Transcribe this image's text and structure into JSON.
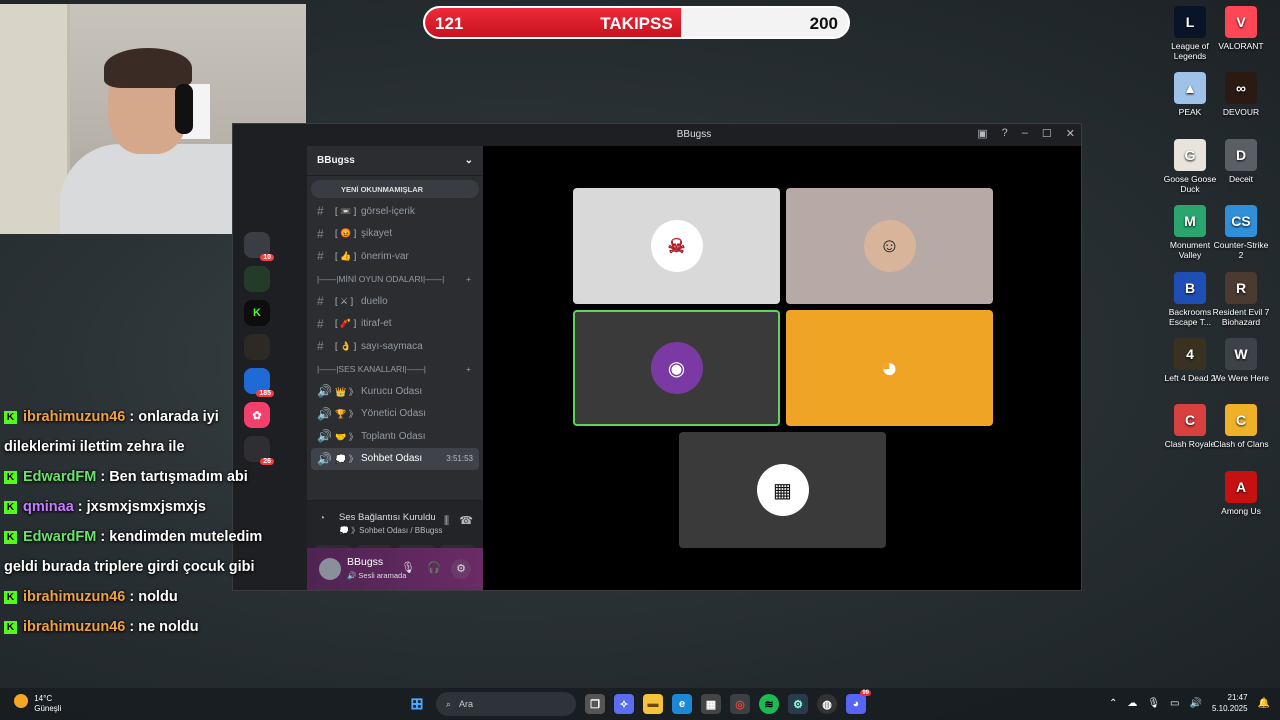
{
  "goal": {
    "current": "121",
    "label": "TAKIPSS",
    "target": "200",
    "progress_fraction": 0.605
  },
  "desktop_icons": [
    {
      "label": "League of Legends",
      "icon": "league-of-legends-icon",
      "bg": "#0a1428",
      "glyph": "L"
    },
    {
      "label": "VALORANT",
      "icon": "valorant-icon",
      "bg": "#ff4655",
      "glyph": "V"
    },
    {
      "label": "PEAK",
      "icon": "peak-icon",
      "bg": "#9fc3e8",
      "glyph": "▲"
    },
    {
      "label": "DEVOUR",
      "icon": "devour-icon",
      "bg": "#2a1a12",
      "glyph": "∞"
    },
    {
      "label": "Goose Goose Duck",
      "icon": "goose-goose-duck-icon",
      "bg": "#e8e4dc",
      "glyph": "G"
    },
    {
      "label": "Deceit",
      "icon": "deceit-icon",
      "bg": "#5a5f66",
      "glyph": "D"
    },
    {
      "label": "Monument Valley",
      "icon": "monument-valley-icon",
      "bg": "#2aa56e",
      "glyph": "M"
    },
    {
      "label": "Counter-Strike 2",
      "icon": "counter-strike-icon",
      "bg": "#2f8fd8",
      "glyph": "CS"
    },
    {
      "label": "Backrooms Escape T...",
      "icon": "backrooms-icon",
      "bg": "#1f4fb5",
      "glyph": "B"
    },
    {
      "label": "Resident Evil 7 Biohazard",
      "icon": "resident-evil-icon",
      "bg": "#4a3a30",
      "glyph": "R"
    },
    {
      "label": "Left 4 Dead 2",
      "icon": "left4dead-icon",
      "bg": "#3a3220",
      "glyph": "4"
    },
    {
      "label": "We Were Here",
      "icon": "we-were-here-icon",
      "bg": "#3d4148",
      "glyph": "W"
    },
    {
      "label": "Clash Royale",
      "icon": "clash-royale-icon",
      "bg": "#d94040",
      "glyph": "C"
    },
    {
      "label": "Clash of Clans",
      "icon": "clash-of-clans-icon",
      "bg": "#f0b12a",
      "glyph": "C"
    },
    {
      "label": "Among Us",
      "icon": "among-us-icon",
      "bg": "#c51111",
      "glyph": "A"
    }
  ],
  "discord": {
    "window_title": "BBugss",
    "server_name": "BBugss",
    "unread_banner": "YENİ OKUNMAMIŞLAR",
    "text_channels": [
      {
        "emoji": "[ 📼 ]",
        "name": "görsel-içerik"
      },
      {
        "emoji": "[ 😡 ]",
        "name": "şikayet"
      },
      {
        "emoji": "[ 👍 ]",
        "name": "önerim-var"
      }
    ],
    "cat_mini": "|——|MİNİ OYUN ODALARI|——|",
    "game_channels": [
      {
        "emoji": "[ ⚔ ]",
        "name": "duello"
      },
      {
        "emoji": "[ 🧨 ]",
        "name": "itiraf-et"
      },
      {
        "emoji": "[ 👌 ]",
        "name": "sayı-saymaca"
      }
    ],
    "cat_voice": "|——|SES KANALLARI|——|",
    "voice_channels": [
      {
        "emoji": "👑 》",
        "name": "Kurucu Odası"
      },
      {
        "emoji": "🏆 》",
        "name": "Yönetici Odası"
      },
      {
        "emoji": "🤝 》",
        "name": "Toplantı Odası"
      },
      {
        "emoji": "💭 》",
        "name": "Sohbet Odası",
        "time": "3:51:53"
      }
    ],
    "voice_status": "Ses Bağlantısı Kuruldu",
    "voice_sub": "💭 》Sohbet Odası / BBugss",
    "user_name": "BBugss",
    "user_status": "🔊 Sesli aramada",
    "server_badges": [
      "10",
      "185",
      "26"
    ]
  },
  "chat": [
    {
      "user": "ibrahimuzun46",
      "color": "#f0a243",
      "text": ": onlarada iyi dileklerimi ilettim zehra ile"
    },
    {
      "user": "EdwardFM",
      "color": "#6ae36a",
      "text": ": Ben tartışmadım abi"
    },
    {
      "user": "qminaa",
      "color": "#c77dff",
      "text": ": jxsmxjsmxjsmxjs"
    },
    {
      "user": "EdwardFM",
      "color": "#6ae36a",
      "text": ": kendimden muteledim geldi burada triplere girdi çocuk gibi"
    },
    {
      "user": "ibrahimuzun46",
      "color": "#f0a243",
      "text": ": noldu"
    },
    {
      "user": "ibrahimuzun46",
      "color": "#f0a243",
      "text": ": ne noldu"
    }
  ],
  "taskbar": {
    "temp": "14°C",
    "weather": "Güneşli",
    "search_placeholder": "Ara",
    "time": "21:47",
    "date": "5.10.2025",
    "notify_badge": "99"
  }
}
